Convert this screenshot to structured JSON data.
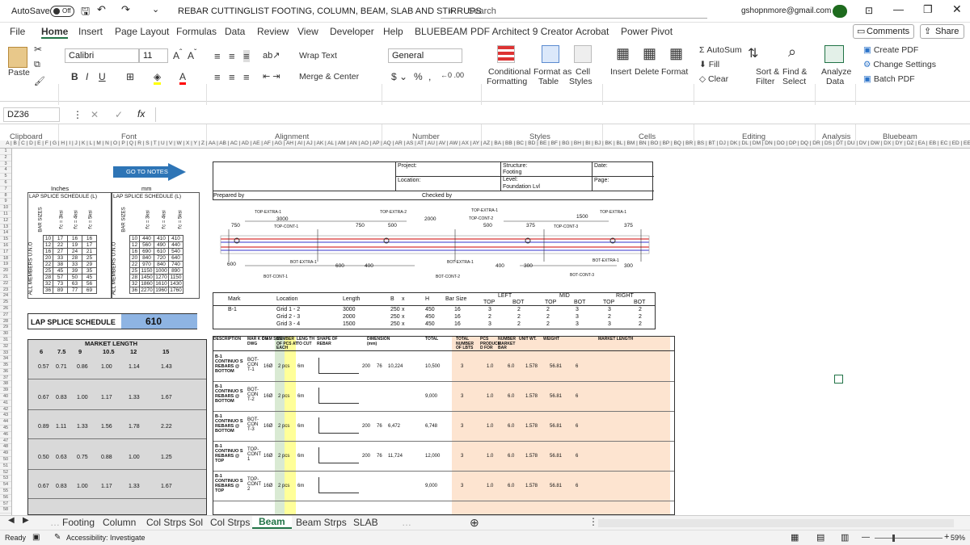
{
  "titlebar": {
    "autosave_label": "AutoSave",
    "autosave_state": "Off",
    "doc_title": "REBAR CUTTINGLIST FOOTING, COLUMN, BEAM, SLAB AND STIRRUPS",
    "search_placeholder": "Search",
    "account": "gshopnmore@gmail.com"
  },
  "menu": [
    "File",
    "Home",
    "Insert",
    "Page Layout",
    "Formulas",
    "Data",
    "Review",
    "View",
    "Developer",
    "Help",
    "BLUEBEAM",
    "PDF Architect 9 Creator",
    "Acrobat",
    "Power Pivot"
  ],
  "menu_right": {
    "comments": "Comments",
    "share": "Share"
  },
  "ribbon": {
    "paste": "Paste",
    "font_name": "Calibri",
    "font_size": "11",
    "wrap_text": "Wrap Text",
    "merge_center": "Merge & Center",
    "number_format": "General",
    "conditional": "Conditional",
    "formatting": "Formatting",
    "format_as": "Format as",
    "table": "Table",
    "cell": "Cell",
    "styles": "Styles",
    "insert": "Insert",
    "delete": "Delete",
    "format": "Format",
    "autosum": "AutoSum",
    "fill": "Fill",
    "clear": "Clear",
    "sort_filter": "Sort &",
    "filter": "Filter",
    "find_select": "Find &",
    "select": "Select",
    "analyze": "Analyze",
    "data": "Data",
    "create_pdf": "Create PDF",
    "change_settings": "Change Settings",
    "batch_pdf": "Batch PDF",
    "groups": [
      "Clipboard",
      "Font",
      "Alignment",
      "Number",
      "Styles",
      "Cells",
      "Editing",
      "Analysis",
      "Bluebeam"
    ]
  },
  "formula_bar": {
    "name_box": "DZ36",
    "fx": "fx",
    "value": ""
  },
  "sheet": {
    "goto_notes": "GO TO NOTES",
    "inches": "Inches",
    "mm": "mm",
    "lap_title_1": "LAP SPLICE SCHEDULE (L)",
    "lap_title_2": "LAP SPLICE SCHEDULE (L)",
    "lap_schedule_label": "LAP SPLICE SCHEDULE",
    "lap_value": "610",
    "side_label_1": "ALL MEMBERS U.N.O",
    "side_label_2": "ALL MEMBERS U.N.O",
    "bar_sizes": "BAR SIZES",
    "fc_cols": [
      "f'c = 3ksi",
      "f'c = 4ksi",
      "f'c = 5ksi"
    ],
    "inch_rows": [
      [
        "10",
        "17",
        "16",
        "16"
      ],
      [
        "12",
        "22",
        "19",
        "17"
      ],
      [
        "16",
        "27",
        "24",
        "21"
      ],
      [
        "20",
        "33",
        "28",
        "25"
      ],
      [
        "22",
        "38",
        "33",
        "29"
      ],
      [
        "25",
        "45",
        "39",
        "35"
      ],
      [
        "28",
        "57",
        "50",
        "45"
      ],
      [
        "32",
        "73",
        "63",
        "56"
      ],
      [
        "36",
        "89",
        "77",
        "69"
      ]
    ],
    "mm_rows": [
      [
        "10",
        "440",
        "410",
        "410"
      ],
      [
        "12",
        "560",
        "490",
        "440"
      ],
      [
        "16",
        "690",
        "610",
        "540"
      ],
      [
        "20",
        "840",
        "720",
        "640"
      ],
      [
        "22",
        "970",
        "840",
        "740"
      ],
      [
        "25",
        "1150",
        "1000",
        "890"
      ],
      [
        "28",
        "1450",
        "1270",
        "1150"
      ],
      [
        "32",
        "1860",
        "1610",
        "1430"
      ],
      [
        "36",
        "2270",
        "1960",
        "1760"
      ]
    ],
    "header_project": "Project:",
    "header_structure": "Structure:",
    "header_structure_val": "Footing",
    "header_date": "Date:",
    "header_location": "Location:",
    "header_level": "Level:",
    "header_level_val": "Foundation Lvl",
    "header_page": "Page:",
    "prepared_by": "Prepared by",
    "checked_by": "Checked by",
    "diagram_labels": {
      "top_extra_1": "TOP-EXTRA-1",
      "top_extra_2": "TOP-EXTRA-2",
      "top_cont_1": "TOP-CONT-1",
      "top_cont_2": "TOP-CONT-2",
      "top_cont_3": "TOP-CONT-3",
      "bot_extra_1": "BOT-EXTRA-1",
      "bot_cont_1": "BOT-CONT-1",
      "bot_cont_2": "BOT-CONT-2",
      "bot_cont_3": "BOT-CONT-3",
      "d3000": "3000",
      "d2000": "2000",
      "d1500": "1500",
      "d750": "750",
      "d500": "500",
      "d375": "375",
      "d600": "600",
      "d400": "400",
      "d300": "300"
    },
    "beam_table_headers": [
      "Mark",
      "Location",
      "Length",
      "B",
      "x",
      "H",
      "Bar Size",
      "LEFT",
      "MID",
      "RIGHT"
    ],
    "beam_sub": [
      "TOP",
      "BOT",
      "TOP",
      "BOT",
      "TOP",
      "BOT"
    ],
    "beam_rows": [
      {
        "mark": "B-1",
        "loc": "Grid 1 - 2",
        "len": "3000",
        "b": "250",
        "x": "x",
        "h": "450",
        "bar": "16",
        "vals": [
          "3",
          "2",
          "2",
          "3",
          "3",
          "2"
        ]
      },
      {
        "mark": "",
        "loc": "Grid 2 - 3",
        "len": "2000",
        "b": "250",
        "x": "x",
        "h": "450",
        "bar": "16",
        "vals": [
          "2",
          "2",
          "2",
          "3",
          "2",
          "2"
        ]
      },
      {
        "mark": "",
        "loc": "Grid 3 - 4",
        "len": "1500",
        "b": "250",
        "x": "x",
        "h": "450",
        "bar": "16",
        "vals": [
          "3",
          "2",
          "2",
          "3",
          "3",
          "2"
        ]
      }
    ],
    "market_length": "MARKET LENGTH",
    "market_cols": [
      "6",
      "7.5",
      "9",
      "10.5",
      "12",
      "15"
    ],
    "market_rows": [
      [
        "0.57",
        "0.71",
        "0.86",
        "1.00",
        "1.14",
        "1.43"
      ],
      [
        "0.67",
        "0.83",
        "1.00",
        "1.17",
        "1.33",
        "1.67"
      ],
      [
        "0.89",
        "1.11",
        "1.33",
        "1.56",
        "1.78",
        "2.22"
      ],
      [
        "0.50",
        "0.63",
        "0.75",
        "0.88",
        "1.00",
        "1.25"
      ],
      [
        "0.67",
        "0.83",
        "1.00",
        "1.17",
        "1.33",
        "1.67"
      ]
    ],
    "cut_headers": [
      "DESCRIPTION",
      "MAR K ON DWG",
      "DIAM SIZE",
      "NUMBER OF PCS AT EACH",
      "LENG TH TO CUT",
      "SHAPE OF REBAR",
      "DIMENSION (mm)",
      "TOTAL",
      "TOTAL NUMBER OF LBTS",
      "PCS PRODUCE D FOR",
      "NUMBER MARKET BAR",
      "UNIT WT.",
      "WEIGHT",
      "MARKET LENGTH"
    ],
    "cut_rows": [
      {
        "desc": "B-1 CONTINUO S REBARS @ BOTTOM",
        "mark": "BOT-CON T-1",
        "diam": "16Ø",
        "pcs": "2 pcs",
        "len": "6m",
        "a": "200",
        "b": "76",
        "c": "10,224",
        "total": "10,500",
        "n": "3",
        "p": "1.0",
        "m": "6.0",
        "uw": "1.578",
        "w": "56.81",
        "ml": "6"
      },
      {
        "desc": "B-1 CONTINUO S REBARS @ BOTTOM",
        "mark": "BOT-CON T-2",
        "diam": "16Ø",
        "pcs": "2 pcs",
        "len": "6m",
        "a": "",
        "b": "",
        "c": "",
        "total": "9,000",
        "n": "3",
        "p": "1.0",
        "m": "6.0",
        "uw": "1.578",
        "w": "56.81",
        "ml": "6"
      },
      {
        "desc": "B-1 CONTINUO S REBARS @ BOTTOM",
        "mark": "BOT-CON T-3",
        "diam": "16Ø",
        "pcs": "2 pcs",
        "len": "6m",
        "a": "200",
        "b": "76",
        "c": "6,472",
        "total": "6,748",
        "n": "3",
        "p": "1.0",
        "m": "6.0",
        "uw": "1.578",
        "w": "56.81",
        "ml": "6"
      },
      {
        "desc": "B-1 CONTINUO S REBARS @ TOP",
        "mark": "TOP-CONT 1",
        "diam": "16Ø",
        "pcs": "2 pcs",
        "len": "6m",
        "a": "200",
        "b": "76",
        "c": "11,724",
        "total": "12,000",
        "n": "3",
        "p": "1.0",
        "m": "6.0",
        "uw": "1.578",
        "w": "56.81",
        "ml": "6"
      },
      {
        "desc": "B-1 CONTINUO S REBARS @ TOP",
        "mark": "TOP-CONT 2",
        "diam": "16Ø",
        "pcs": "2 pcs",
        "len": "6m",
        "a": "",
        "b": "",
        "c": "",
        "total": "9,000",
        "n": "3",
        "p": "1.0",
        "m": "6.0",
        "uw": "1.578",
        "w": "56.81",
        "ml": "6"
      }
    ]
  },
  "tabs": [
    "Footing",
    "Column",
    "Col Strps Sol",
    "Col Strps",
    "Beam",
    "Beam Strps",
    "SLAB"
  ],
  "active_tab": "Beam",
  "status": {
    "ready": "Ready",
    "accessibility": "Accessibility: Investigate",
    "zoom": "59%"
  },
  "colors": {
    "accent": "#217346",
    "lap_blue": "#8eb4e3",
    "cream": "#ffe7cc",
    "yellow": "#ffff99",
    "green_col": "#d9ead3",
    "grey_tbl": "#d9d9d9"
  }
}
